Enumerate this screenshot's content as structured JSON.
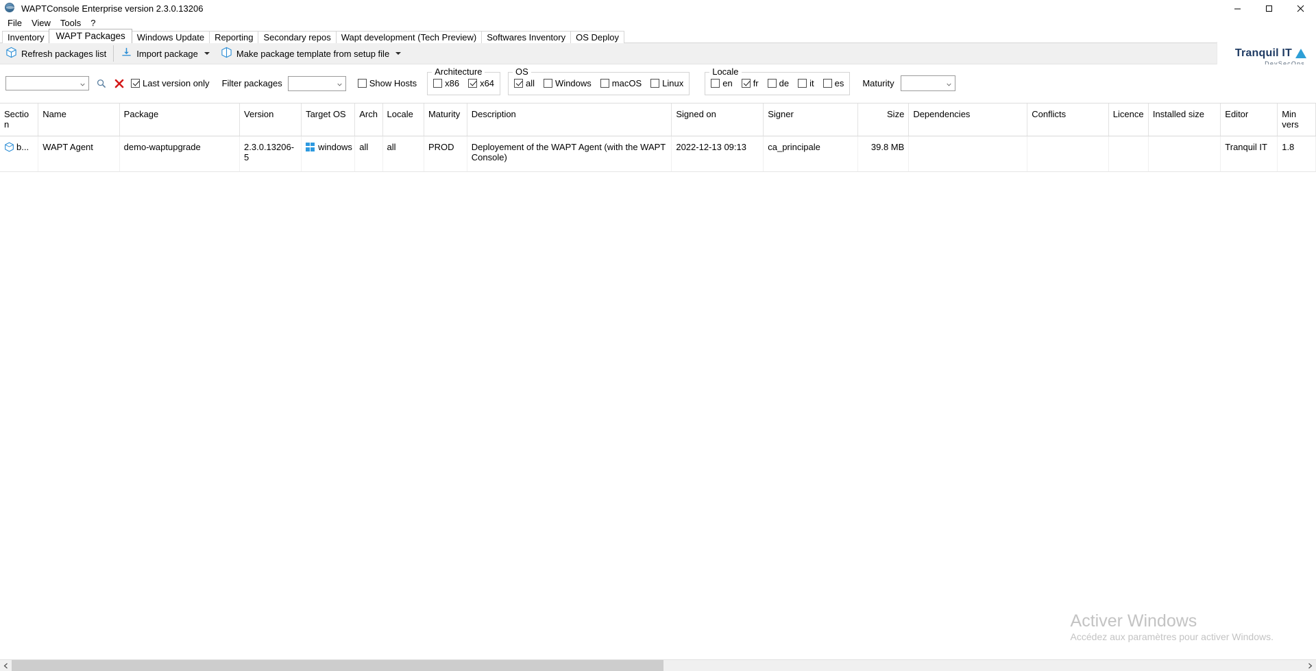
{
  "window": {
    "title": "WAPTConsole Enterprise version 2.3.0.13206",
    "app_icon": "wapt-globe-icon",
    "minimize": "—",
    "maximize": "❐",
    "close": "✕"
  },
  "menubar": {
    "items": [
      {
        "label": "File",
        "name": "menu-file"
      },
      {
        "label": "View",
        "name": "menu-view"
      },
      {
        "label": "Tools",
        "name": "menu-tools"
      },
      {
        "label": "?",
        "name": "menu-help"
      }
    ]
  },
  "tabs": {
    "active": "WAPT Packages",
    "items": [
      {
        "label": "Inventory"
      },
      {
        "label": "WAPT Packages"
      },
      {
        "label": "Windows Update"
      },
      {
        "label": "Reporting"
      },
      {
        "label": "Secondary repos"
      },
      {
        "label": "Wapt development (Tech Preview)"
      },
      {
        "label": "Softwares Inventory"
      },
      {
        "label": "OS Deploy"
      }
    ]
  },
  "toolbar": {
    "refresh_label": "Refresh packages list",
    "import_label": "Import package",
    "template_label": "Make package template from setup file"
  },
  "logo": {
    "name": "Tranquil IT",
    "tagline": "DevSecOps",
    "accent": "#2e9fd6",
    "text_color": "#1f3b63"
  },
  "filters": {
    "search_value": "",
    "search_placeholder": "",
    "search_icon": "search-icon",
    "clear_icon": "clear-red-x-icon",
    "last_version_only": {
      "label": "Last version only",
      "checked": true
    },
    "filter_packages_label": "Filter packages",
    "filter_packages_value": "",
    "show_hosts": {
      "label": "Show Hosts",
      "checked": false
    },
    "architecture": {
      "title": "Architecture",
      "items": [
        {
          "label": "x86",
          "checked": false
        },
        {
          "label": "x64",
          "checked": true
        }
      ]
    },
    "os": {
      "title": "OS",
      "items": [
        {
          "label": "all",
          "checked": true
        },
        {
          "label": "Windows",
          "checked": false
        },
        {
          "label": "macOS",
          "checked": false
        },
        {
          "label": "Linux",
          "checked": false
        }
      ]
    },
    "locale": {
      "title": "Locale",
      "items": [
        {
          "label": "en",
          "checked": false
        },
        {
          "label": "fr",
          "checked": true
        },
        {
          "label": "de",
          "checked": false
        },
        {
          "label": "it",
          "checked": false
        },
        {
          "label": "es",
          "checked": false
        }
      ]
    },
    "maturity": {
      "label": "Maturity",
      "value": ""
    }
  },
  "table": {
    "columns": [
      {
        "key": "section",
        "label": "Section",
        "align": "left"
      },
      {
        "key": "name",
        "label": "Name",
        "align": "left"
      },
      {
        "key": "package",
        "label": "Package",
        "align": "left"
      },
      {
        "key": "version",
        "label": "Version",
        "align": "left"
      },
      {
        "key": "target_os",
        "label": "Target OS",
        "align": "left"
      },
      {
        "key": "arch",
        "label": "Arch",
        "align": "left"
      },
      {
        "key": "locale",
        "label": "Locale",
        "align": "left"
      },
      {
        "key": "maturity",
        "label": "Maturity",
        "align": "left"
      },
      {
        "key": "description",
        "label": "Description",
        "align": "left"
      },
      {
        "key": "signed_on",
        "label": "Signed on",
        "align": "left"
      },
      {
        "key": "signer",
        "label": "Signer",
        "align": "left"
      },
      {
        "key": "size",
        "label": "Size",
        "align": "right"
      },
      {
        "key": "dependencies",
        "label": "Dependencies",
        "align": "left"
      },
      {
        "key": "conflicts",
        "label": "Conflicts",
        "align": "left"
      },
      {
        "key": "licence",
        "label": "Licence",
        "align": "left"
      },
      {
        "key": "installed_size",
        "label": "Installed size",
        "align": "left"
      },
      {
        "key": "editor",
        "label": "Editor",
        "align": "left"
      },
      {
        "key": "min_vers",
        "label": "Min vers",
        "align": "left"
      }
    ],
    "rows": [
      {
        "section": "b...",
        "section_icon": "package-box-icon",
        "name": "WAPT Agent",
        "package": "demo-waptupgrade",
        "version": "2.3.0.13206-5",
        "target_os": "windows",
        "target_os_icon": "windows-logo-icon",
        "arch": "all",
        "locale": "all",
        "maturity": "PROD",
        "description": "Deployement of the WAPT Agent (with the WAPT Console)",
        "signed_on": "2022-12-13 09:13",
        "signer": "ca_principale",
        "size": "39.8 MB",
        "dependencies": "",
        "conflicts": "",
        "licence": "",
        "installed_size": "",
        "editor": "Tranquil IT",
        "min_vers": "1.8"
      }
    ]
  },
  "watermark": {
    "line1": "Activer Windows",
    "line2": "Accédez aux paramètres pour activer Windows."
  },
  "scrollbar": {
    "left_arrow": "‹",
    "right_arrow": "›"
  }
}
